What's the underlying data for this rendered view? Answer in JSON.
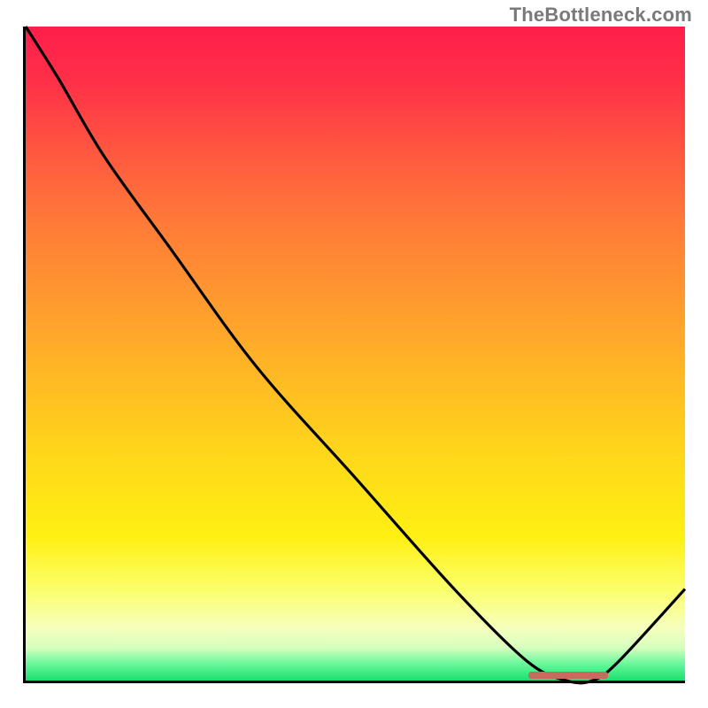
{
  "watermark": "TheBottleneck.com",
  "chart_data": {
    "type": "line",
    "title": "",
    "xlabel": "",
    "ylabel": "",
    "x": [
      0,
      0.05,
      0.12,
      0.22,
      0.35,
      0.5,
      0.65,
      0.76,
      0.82,
      0.86,
      0.9,
      1.0
    ],
    "y": [
      1.0,
      0.92,
      0.8,
      0.66,
      0.48,
      0.31,
      0.14,
      0.03,
      0.0,
      0.0,
      0.03,
      0.14
    ],
    "xlim": [
      0,
      1
    ],
    "ylim": [
      0,
      1
    ],
    "annotations": [
      {
        "type": "band",
        "x_start": 0.76,
        "x_end": 0.88,
        "y": 0.005
      }
    ],
    "background": "vertical-gradient red→yellow→green (bottleneck heat scale)"
  },
  "colors": {
    "curve": "#000000",
    "marker": "#c96a5f",
    "axis": "#000000"
  }
}
